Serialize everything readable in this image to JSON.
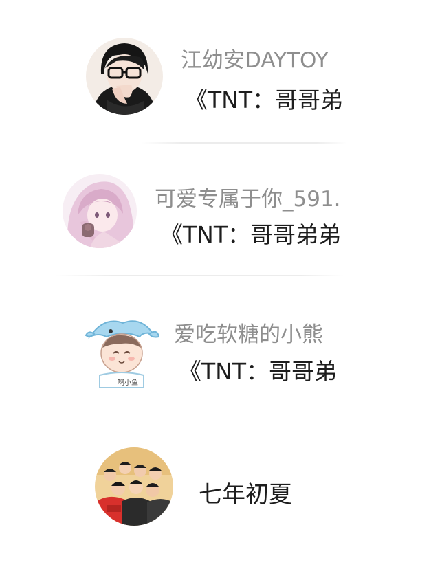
{
  "conversations": [
    {
      "name": "江幼安DAYTOY",
      "preview": "《TNT：哥哥弟",
      "avatar_icon": "anime-boy-glasses-avatar"
    },
    {
      "name": "可爱专属于你_591...",
      "preview": "《TNT：哥哥弟弟",
      "avatar_icon": "anime-girl-pink-hair-avatar"
    },
    {
      "name": "爱吃软糖的小熊",
      "preview": "《TNT：哥哥弟",
      "avatar_icon": "cartoon-whale-hat-child-avatar",
      "avatar_caption": "啊小鱼"
    },
    {
      "name": "七年初夏",
      "avatar_icon": "group-photo-avatar"
    }
  ],
  "colors": {
    "name_text": "#8e8e8e",
    "preview_text": "#1d1d1d",
    "divider": "#ececec",
    "background": "#ffffff"
  }
}
